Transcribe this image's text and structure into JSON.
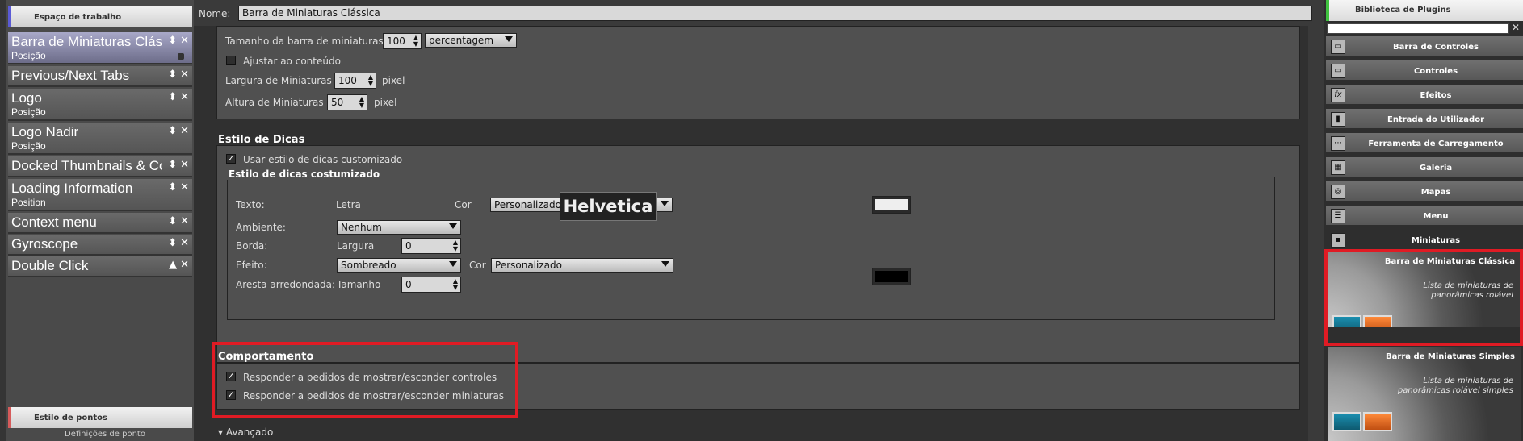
{
  "workspace": {
    "header": "Espaço de trabalho",
    "items": [
      {
        "title": "Barra de Miniaturas Clássica",
        "sub": "Posição"
      },
      {
        "title": "Previous/Next Tabs",
        "sub": ""
      },
      {
        "title": "Logo",
        "sub": "Posição"
      },
      {
        "title": "Logo Nadir",
        "sub": "Posição"
      },
      {
        "title": "Docked Thumbnails & Controls",
        "sub": ""
      },
      {
        "title": "Loading Information",
        "sub": "Position"
      },
      {
        "title": "Context menu",
        "sub": ""
      },
      {
        "title": "Gyroscope",
        "sub": ""
      },
      {
        "title": "Double Click",
        "sub": ""
      }
    ],
    "points_header": "Estilo de pontos",
    "points_sub": "Definições de ponto"
  },
  "name": {
    "label": "Nome:",
    "value": "Barra de Miniaturas Clássica"
  },
  "size": {
    "bar_label": "Tamanho da barra de miniaturas",
    "bar_value": "100",
    "bar_unit": "percentagem",
    "fit_label": "Ajustar ao conteúdo",
    "width_label": "Largura de Miniaturas",
    "width_value": "100",
    "width_unit": "pixel",
    "height_label": "Altura de Miniaturas",
    "height_value": "50",
    "height_unit": "pixel"
  },
  "tips": {
    "title": "Estilo de Dicas",
    "use_custom": "Usar estilo de dicas customizado",
    "custom_title": "Estilo de dicas costumizado",
    "text_label": "Texto:",
    "font_label": "Letra",
    "font_value": "Helvetica",
    "cor_label": "Cor",
    "text_color": "Personalizado",
    "text_swatch": "#eeeeee",
    "ambient_label": "Ambiente:",
    "ambient_value": "Nenhum",
    "border_label": "Borda:",
    "border_width_label": "Largura",
    "border_width_value": "0",
    "effect_label": "Efeito:",
    "effect_value": "Sombreado",
    "effect_color": "Personalizado",
    "effect_swatch": "#000000",
    "rounded_label": "Aresta arredondada:",
    "rounded_size_label": "Tamanho",
    "rounded_size_value": "0"
  },
  "behavior": {
    "title": "Comportamento",
    "opt1": "Responder a pedidos de mostrar/esconder controles",
    "opt2": "Responder a pedidos de mostrar/esconder miniaturas"
  },
  "advanced": {
    "label": "Avançado"
  },
  "library": {
    "header": "Biblioteca de Plugins",
    "categories": [
      {
        "label": "Barra de Controles",
        "icon": "toolbar-icon"
      },
      {
        "label": "Controles",
        "icon": "controls-icon"
      },
      {
        "label": "Efeitos",
        "icon": "fx-icon"
      },
      {
        "label": "Entrada do Utilizador",
        "icon": "user-input-icon"
      },
      {
        "label": "Ferramenta de Carregamento",
        "icon": "loading-tool-icon"
      },
      {
        "label": "Galeria",
        "icon": "gallery-icon"
      },
      {
        "label": "Mapas",
        "icon": "maps-icon"
      },
      {
        "label": "Menu",
        "icon": "menu-icon"
      },
      {
        "label": "Miniaturas",
        "icon": "thumbnails-icon"
      }
    ],
    "cards": [
      {
        "title": "Barra de Miniaturas Clássica",
        "desc": "Lista de miniaturas de panorâmicas rolável"
      },
      {
        "title": "Barra de Miniaturas Simples",
        "desc": "Lista de miniaturas de panorâmicas rolável simples"
      }
    ]
  },
  "colors": {
    "highlight": "#e01b24",
    "workspace_accent": "#5b5bd6",
    "points_accent": "#d65b5b",
    "library_accent": "#3fc23f"
  }
}
